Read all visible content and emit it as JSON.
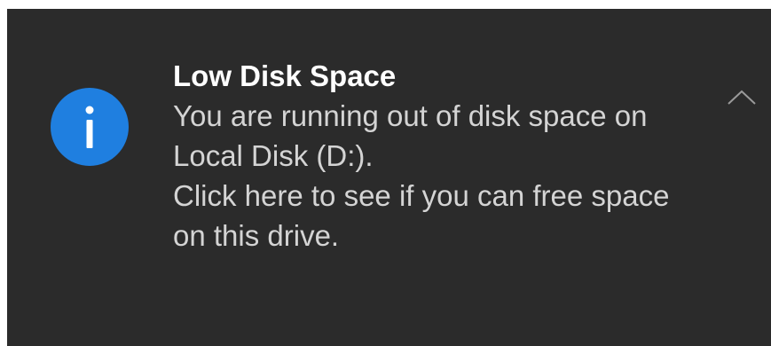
{
  "notification": {
    "title": "Low Disk Space",
    "message_line1": "You are running out of disk space on Local Disk (D:).",
    "message_line2": "Click here to see if you can free space on this drive.",
    "icon": "info-icon",
    "collapse_icon": "chevron-up-icon"
  },
  "colors": {
    "background": "#2b2b2b",
    "accent": "#1f7fe0",
    "title": "#ffffff",
    "body_text": "#d4d4d4"
  }
}
